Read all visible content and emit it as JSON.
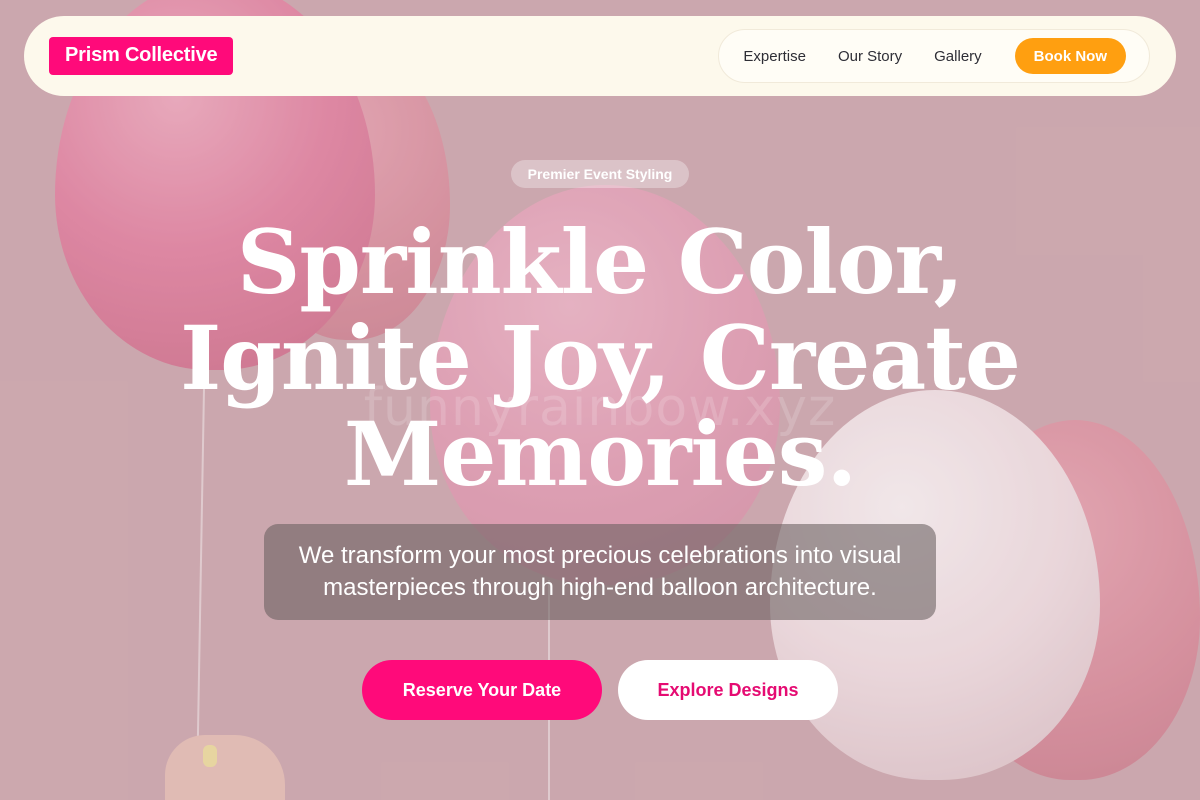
{
  "nav": {
    "logo": "Prism Collective",
    "links": [
      "Expertise",
      "Our Story",
      "Gallery"
    ],
    "cta": "Book Now"
  },
  "hero": {
    "badge": "Premier Event Styling",
    "headline_lines": [
      "Sprinkle Color,",
      "Ignite Joy, Create",
      "Memories."
    ],
    "subtitle": "We transform your most precious celebrations into visual masterpieces through high-end balloon architecture.",
    "primary_cta": "Reserve Your Date",
    "secondary_cta": "Explore Designs",
    "watermark": "funnyrainbow.xyz"
  },
  "colors": {
    "brand_pink": "#ff0a7a",
    "accent_orange": "#ff9f10",
    "nav_background": "#fdf9ec"
  }
}
